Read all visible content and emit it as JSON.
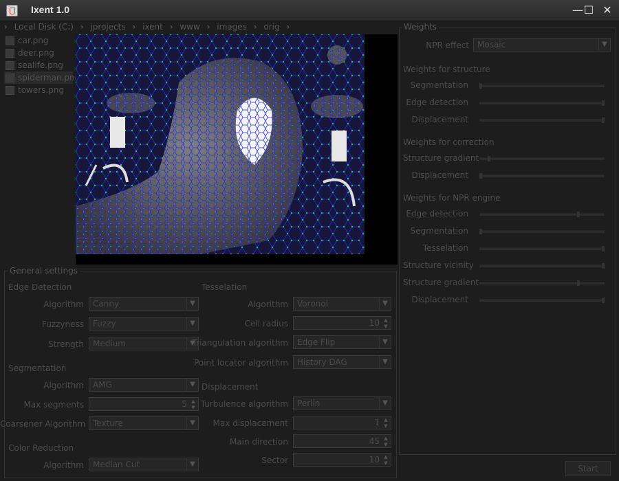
{
  "window": {
    "title": "Ixent 1.0",
    "minimize_icon": "—",
    "maximize_icon": "☐",
    "close_icon": "✕"
  },
  "breadcrumb": [
    "Local Disk (C:)",
    "jprojects",
    "ixent",
    "www",
    "images",
    "orig"
  ],
  "files": [
    {
      "name": "car.png",
      "selected": false
    },
    {
      "name": "deer.png",
      "selected": false
    },
    {
      "name": "sealife.png",
      "selected": false
    },
    {
      "name": "spiderman.png",
      "selected": true
    },
    {
      "name": "towers.png",
      "selected": false
    }
  ],
  "general": {
    "title": "General settings",
    "edge": {
      "title": "Edge Detection",
      "algorithm_label": "Algorithm",
      "algorithm": "Canny",
      "fuzzyness_label": "Fuzzyness",
      "fuzzyness": "Fuzzy",
      "strength_label": "Strength",
      "strength": "Medium"
    },
    "segmentation": {
      "title": "Segmentation",
      "algorithm_label": "Algorithm",
      "algorithm": "AMG",
      "max_segments_label": "Max segments",
      "max_segments": "5",
      "coarsener_label": "Coarsener Algorithm",
      "coarsener": "Texture"
    },
    "color": {
      "title": "Color Reduction",
      "algorithm_label": "Algorithm",
      "algorithm": "Median Cut"
    },
    "tesselation": {
      "title": "Tesselation",
      "algorithm_label": "Algorithm",
      "algorithm": "Voronoi",
      "cell_radius_label": "Cell radius",
      "cell_radius": "10",
      "triangulation_label": "Triangulation algorithm",
      "triangulation": "Edge Flip",
      "point_locator_label": "Point locator algorithm",
      "point_locator": "History DAG"
    },
    "displacement": {
      "title": "Displacement",
      "turbulence_label": "Turbulence algorithm",
      "turbulence": "Perlin",
      "max_displacement_label": "Max displacement",
      "max_displacement": "1",
      "main_direction_label": "Main direction",
      "main_direction": "45",
      "sector_label": "Sector",
      "sector": "10"
    }
  },
  "weights": {
    "title": "Weights",
    "npr_effect_label": "NPR effect",
    "npr_effect": "Mosaic",
    "structure": {
      "title": "Weights for structure",
      "segmentation_label": "Segmentation",
      "segmentation": 0.0,
      "edge_label": "Edge detection",
      "edge": 1.0,
      "displacement_label": "Displacement",
      "displacement": 1.0
    },
    "correction": {
      "title": "Weights for correction",
      "gradient_label": "Structure gradient",
      "gradient": 0.07,
      "displacement_label": "Displacement",
      "displacement": 0.0
    },
    "npr": {
      "title": "Weights for NPR engine",
      "edge_label": "Edge detection",
      "edge": 0.8,
      "segmentation_label": "Segmentation",
      "segmentation": 0.0,
      "tesselation_label": "Tesselation",
      "tesselation": 1.0,
      "vicinity_label": "Structure vicinity",
      "vicinity": 1.0,
      "gradient_label": "Structure gradient",
      "gradient": 0.8,
      "displacement_label": "Displacement",
      "displacement": 1.0
    },
    "start_label": "Start"
  }
}
